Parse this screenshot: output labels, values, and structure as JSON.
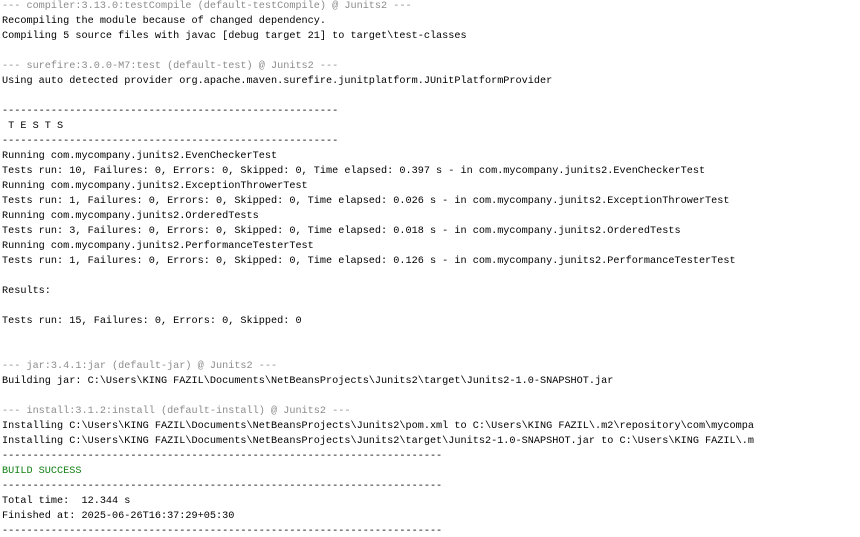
{
  "console": {
    "lines": [
      {
        "text": "--- compiler:3.13.0:testCompile (default-testCompile) @ Junits2 ---",
        "style": "gray"
      },
      {
        "text": "Recompiling the module because of changed dependency.",
        "style": "normal"
      },
      {
        "text": "Compiling 5 source files with javac [debug target 21] to target\\test-classes",
        "style": "normal"
      },
      {
        "text": "",
        "style": "normal"
      },
      {
        "text": "--- surefire:3.0.0-M7:test (default-test) @ Junits2 ---",
        "style": "gray"
      },
      {
        "text": "Using auto detected provider org.apache.maven.surefire.junitplatform.JUnitPlatformProvider",
        "style": "normal"
      },
      {
        "text": "",
        "style": "normal"
      },
      {
        "text": "-------------------------------------------------------",
        "style": "normal"
      },
      {
        "text": " T E S T S",
        "style": "normal"
      },
      {
        "text": "-------------------------------------------------------",
        "style": "normal"
      },
      {
        "text": "Running com.mycompany.junits2.EvenCheckerTest",
        "style": "normal"
      },
      {
        "text": "Tests run: 10, Failures: 0, Errors: 0, Skipped: 0, Time elapsed: 0.397 s - in com.mycompany.junits2.EvenCheckerTest",
        "style": "normal"
      },
      {
        "text": "Running com.mycompany.junits2.ExceptionThrowerTest",
        "style": "normal"
      },
      {
        "text": "Tests run: 1, Failures: 0, Errors: 0, Skipped: 0, Time elapsed: 0.026 s - in com.mycompany.junits2.ExceptionThrowerTest",
        "style": "normal"
      },
      {
        "text": "Running com.mycompany.junits2.OrderedTests",
        "style": "normal"
      },
      {
        "text": "Tests run: 3, Failures: 0, Errors: 0, Skipped: 0, Time elapsed: 0.018 s - in com.mycompany.junits2.OrderedTests",
        "style": "normal"
      },
      {
        "text": "Running com.mycompany.junits2.PerformanceTesterTest",
        "style": "normal"
      },
      {
        "text": "Tests run: 1, Failures: 0, Errors: 0, Skipped: 0, Time elapsed: 0.126 s - in com.mycompany.junits2.PerformanceTesterTest",
        "style": "normal"
      },
      {
        "text": "",
        "style": "normal"
      },
      {
        "text": "Results:",
        "style": "normal"
      },
      {
        "text": "",
        "style": "normal"
      },
      {
        "text": "Tests run: 15, Failures: 0, Errors: 0, Skipped: 0",
        "style": "normal"
      },
      {
        "text": "",
        "style": "normal"
      },
      {
        "text": "",
        "style": "normal"
      },
      {
        "text": "--- jar:3.4.1:jar (default-jar) @ Junits2 ---",
        "style": "gray"
      },
      {
        "text": "Building jar: C:\\Users\\KING FAZIL\\Documents\\NetBeansProjects\\Junits2\\target\\Junits2-1.0-SNAPSHOT.jar",
        "style": "normal"
      },
      {
        "text": "",
        "style": "normal"
      },
      {
        "text": "--- install:3.1.2:install (default-install) @ Junits2 ---",
        "style": "gray"
      },
      {
        "text": "Installing C:\\Users\\KING FAZIL\\Documents\\NetBeansProjects\\Junits2\\pom.xml to C:\\Users\\KING FAZIL\\.m2\\repository\\com\\mycompa",
        "style": "normal"
      },
      {
        "text": "Installing C:\\Users\\KING FAZIL\\Documents\\NetBeansProjects\\Junits2\\target\\Junits2-1.0-SNAPSHOT.jar to C:\\Users\\KING FAZIL\\.m",
        "style": "normal"
      },
      {
        "text": "------------------------------------------------------------------------",
        "style": "normal"
      },
      {
        "text": "BUILD SUCCESS",
        "style": "green"
      },
      {
        "text": "------------------------------------------------------------------------",
        "style": "normal"
      },
      {
        "text": "Total time:  12.344 s",
        "style": "normal"
      },
      {
        "text": "Finished at: 2025-06-26T16:37:29+05:30",
        "style": "normal"
      },
      {
        "text": "------------------------------------------------------------------------",
        "style": "normal"
      }
    ]
  },
  "colors": {
    "background": "#ffffff",
    "text": "#000000",
    "plugin_header": "#8c8c8c",
    "success": "#0f7f12"
  }
}
